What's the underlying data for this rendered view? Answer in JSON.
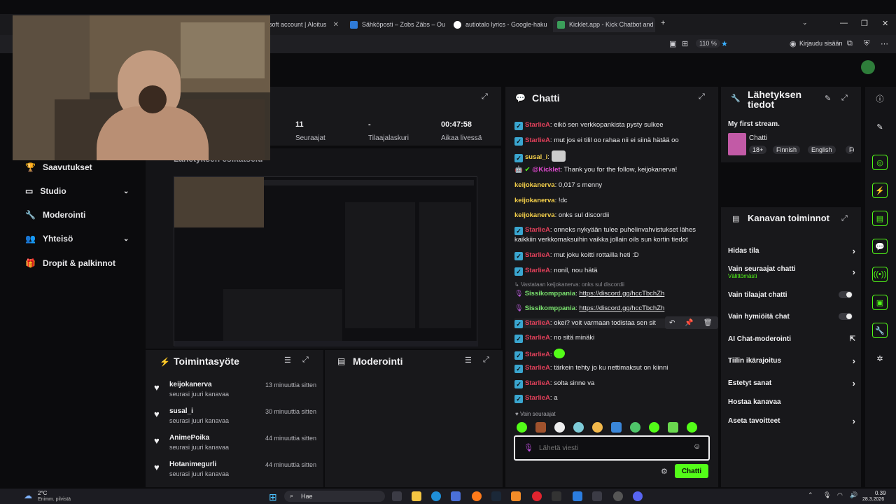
{
  "browser": {
    "tabs": [
      {
        "label": "soft account | Aloitus"
      },
      {
        "label": "Sähköposti – Zobs Zäbs – Outlo"
      },
      {
        "label": "autiotalo lyrics - Google-haku"
      },
      {
        "label": "Kicklet.app - Kick Chatbot and C"
      }
    ],
    "zoom": "110 %",
    "signin": "Kirjaudu sisään"
  },
  "sidebar": {
    "items": [
      {
        "label": "Saavutukset"
      },
      {
        "label": "Studio"
      },
      {
        "label": "Moderointi"
      },
      {
        "label": "Yhteisö"
      },
      {
        "label": "Dropit & palkinnot"
      }
    ]
  },
  "stats": [
    {
      "value": "11",
      "label": "Seuraajat"
    },
    {
      "value": "-",
      "label": "Tilaajalaskuri"
    },
    {
      "value": "00:47:58",
      "label": "Aikaa livessä"
    }
  ],
  "preview": {
    "title": "Lähetyksen esikatselu"
  },
  "activity": {
    "title": "Toimintasyöte",
    "items": [
      {
        "name": "keijokanerva",
        "sub": "seurasi juuri kanavaa",
        "time": "13 minuuttia sitten"
      },
      {
        "name": "susal_i",
        "sub": "seurasi juuri kanavaa",
        "time": "30 minuuttia sitten"
      },
      {
        "name": "AnimePoika",
        "sub": "seurasi juuri kanavaa",
        "time": "44 minuuttia sitten"
      },
      {
        "name": "Hotanimegurli",
        "sub": "seurasi juuri kanavaa",
        "time": "44 minuuttia sitten"
      }
    ]
  },
  "moderation": {
    "title": "Moderointi"
  },
  "chat": {
    "title": "Chatti",
    "messages": [
      {
        "user": "StarlieA",
        "text": "eikö sen verkkopankista pysty sulkee"
      },
      {
        "user": "StarlieA",
        "text": "mut jos ei tilil oo rahaa nii ei siinä hätää oo"
      },
      {
        "user": "susal_i",
        "text": ""
      },
      {
        "user": "@Kicklet",
        "text": "Thank you for the follow, keijokanerva!"
      },
      {
        "user": "keijokanerva",
        "text": "0,017 s menny"
      },
      {
        "user": "keijokanerva",
        "text": "!dc"
      },
      {
        "user": "keijokanerva",
        "text": "onks sul discordii"
      },
      {
        "user": "StarlieA",
        "text": "onneks nykyään tulee puhelinvahvistukset lähes kaikkiin verkkomaksuihin vaikka jollain oils sun kortin tiedot"
      },
      {
        "user": "StarlieA",
        "text": "mut joku koitti rottailla heti :D"
      },
      {
        "user": "StarlieA",
        "text": "nonil, nou hätä"
      },
      {
        "reply": "Vastataan keijokanerva: onks sul discordii"
      },
      {
        "user": "Sissikomppania",
        "text": "https://discord.gg/hccTbchZh"
      },
      {
        "user": "Sissikomppania",
        "text": "https://discord.gg/hccTbchZh"
      },
      {
        "user": "StarlieA",
        "text": "okei? voit varmaan todistaa sen sit"
      },
      {
        "user": "StarlieA",
        "text": "no sitä minäki"
      },
      {
        "user": "StarlieA",
        "text": ""
      },
      {
        "user": "StarlieA",
        "text": "tärkein tehty jo ku nettimaksut on kiinni"
      },
      {
        "user": "StarlieA",
        "text": "solta sinne va"
      },
      {
        "user": "StarlieA",
        "text": "a"
      }
    ],
    "followers_only": "Vain seuraajat",
    "input_placeholder": "Lähetä viesti",
    "send_label": "Chatti"
  },
  "stream_info": {
    "title": "Lähetyksen tiedot",
    "stream_title": "My first stream.",
    "category": "Chatti",
    "tags": [
      "18+",
      "Finnish",
      "English",
      "Fi"
    ]
  },
  "channel_actions": {
    "title": "Kanavan toiminnot",
    "items": [
      {
        "label": "Hidas tila",
        "control": "chevron"
      },
      {
        "label": "Vain seuraajat chatti",
        "sub": "Välittömästi",
        "control": "chevron"
      },
      {
        "label": "Vain tilaajat chatti",
        "control": "toggle"
      },
      {
        "label": "Vain hymiöitä chat",
        "control": "toggle"
      },
      {
        "label": "AI Chat-moderointi",
        "control": "external"
      },
      {
        "label": "Tiilin ikärajoitus",
        "control": "chevron"
      },
      {
        "label": "Estetyt sanat",
        "control": "chevron"
      },
      {
        "label": "Hostaa kanavaa",
        "control": "none"
      },
      {
        "label": "Aseta tavoitteet",
        "control": "chevron"
      }
    ]
  },
  "taskbar": {
    "weather_temp": "2°C",
    "weather_desc": "Enimm. pilvistä",
    "search": "Hae",
    "time": "0.39",
    "date": "28.3.2026"
  },
  "colors": {
    "accent": "#53fc18",
    "panel": "#18181b",
    "bg": "#0b0b0d"
  }
}
